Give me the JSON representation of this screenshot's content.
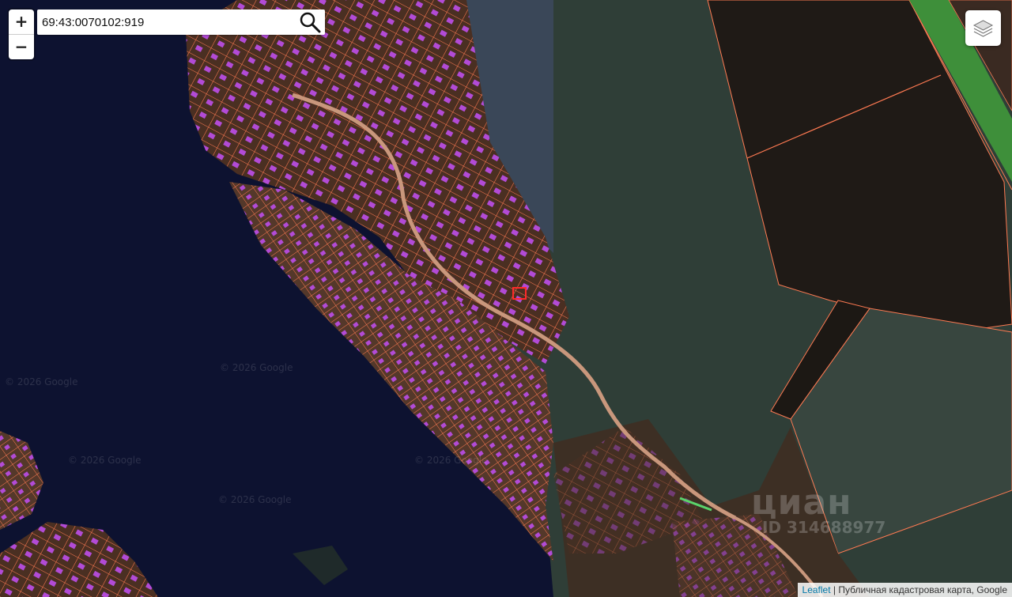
{
  "search": {
    "value": "69:43:0070102:919",
    "icon": "search-icon"
  },
  "zoom": {
    "in_label": "+",
    "out_label": "−"
  },
  "layers": {
    "icon": "layers-icon"
  },
  "attribution": {
    "leaflet": "Leaflet",
    "separator": " | ",
    "text": "Публичная кадастровая карта, Google"
  },
  "watermarks": [
    "© 2026 Google",
    "© 2026 Google",
    "© 2026 Google",
    "© 2026 Google",
    "© 2026 Google"
  ],
  "cian": {
    "logo": "циан",
    "id": "ID 314688977"
  },
  "colors": {
    "water": "#0d1230",
    "forest": "#2c3a33",
    "dark_forest": "#1f1a16",
    "parcel_outline": "#ff7a52",
    "building": "#b24bd6",
    "selected_parcel": "#ff2a2a",
    "field": "#3e8f3a"
  }
}
